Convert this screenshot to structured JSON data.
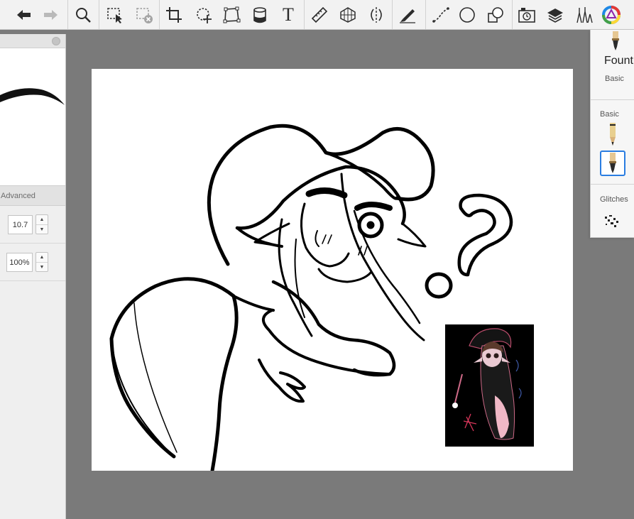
{
  "toolbar": {
    "tools": [
      {
        "name": "undo-icon"
      },
      {
        "name": "redo-icon"
      },
      {
        "name": "zoom-icon"
      },
      {
        "name": "selection-icon"
      },
      {
        "name": "deselect-icon"
      },
      {
        "name": "crop-icon"
      },
      {
        "name": "transform-icon"
      },
      {
        "name": "distort-icon"
      },
      {
        "name": "fill-bucket-icon"
      },
      {
        "name": "text-icon"
      },
      {
        "name": "ruler-icon"
      },
      {
        "name": "perspective-grid-icon"
      },
      {
        "name": "symmetry-icon"
      },
      {
        "name": "brush-icon"
      },
      {
        "name": "stroke-line-icon"
      },
      {
        "name": "ellipse-icon"
      },
      {
        "name": "shape-icon"
      },
      {
        "name": "time-lapse-icon"
      },
      {
        "name": "layers-icon"
      },
      {
        "name": "brush-library-icon"
      },
      {
        "name": "color-wheel-icon"
      }
    ],
    "text_tool_glyph": "T"
  },
  "brush_panel": {
    "advanced_label": "Advanced",
    "size_value": "10.7",
    "opacity_value": "100%"
  },
  "brush_library": {
    "current_brush_name": "Fount",
    "current_brush_set": "Basic",
    "categories": [
      "Basic",
      "Glitches"
    ],
    "brushes": [
      {
        "name": "pencil-brush",
        "selected": false
      },
      {
        "name": "fountain-pen-brush",
        "selected": true
      }
    ]
  },
  "colors": {
    "canvas_background": "#7a7a7a",
    "toolbar": "#f2f2f2",
    "selected_brush_outline": "#2a7de1",
    "color_wheel": [
      "#e53935",
      "#fdd835",
      "#43a047",
      "#1e88e5",
      "#8e24aa"
    ]
  }
}
